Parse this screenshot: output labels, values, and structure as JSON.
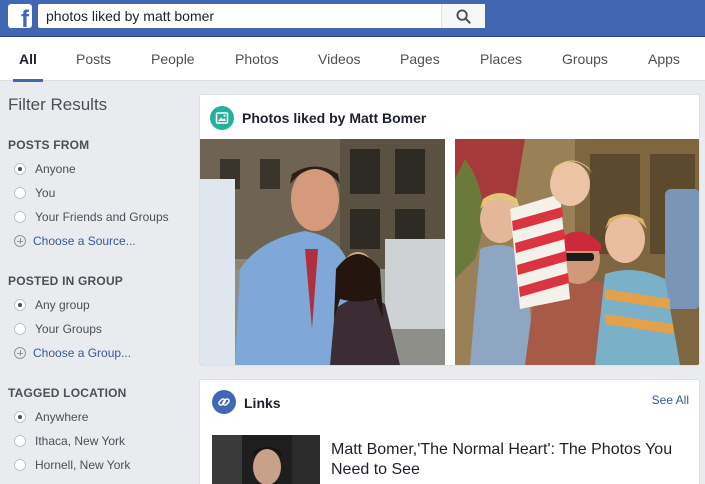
{
  "search": {
    "query": "photos liked by matt bomer"
  },
  "tabs": [
    {
      "label": "All",
      "active": true
    },
    {
      "label": "Posts"
    },
    {
      "label": "People"
    },
    {
      "label": "Photos"
    },
    {
      "label": "Videos"
    },
    {
      "label": "Pages"
    },
    {
      "label": "Places"
    },
    {
      "label": "Groups"
    },
    {
      "label": "Apps"
    }
  ],
  "sidebar": {
    "title": "Filter Results",
    "posts_from": {
      "heading": "POSTS FROM",
      "options": [
        "Anyone",
        "You",
        "Your Friends and Groups"
      ],
      "selected": 0,
      "choose": "Choose a Source..."
    },
    "posted_in_group": {
      "heading": "POSTED IN GROUP",
      "options": [
        "Any group",
        "Your Groups"
      ],
      "selected": 0,
      "choose": "Choose a Group..."
    },
    "tagged_location": {
      "heading": "TAGGED LOCATION",
      "options": [
        "Anywhere",
        "Ithaca, New York",
        "Hornell, New York"
      ],
      "selected": 0
    }
  },
  "photos_card": {
    "title": "Photos liked by Matt Bomer",
    "icon": "photo-icon",
    "icon_color": "#23b19d"
  },
  "links_card": {
    "title": "Links",
    "icon": "link-icon",
    "icon_color": "#4267b2",
    "see_all": "See All",
    "item_title": "Matt Bomer,'The Normal Heart': The Photos You Need to See"
  },
  "colors": {
    "brand": "#4267b2",
    "link": "#365899"
  }
}
